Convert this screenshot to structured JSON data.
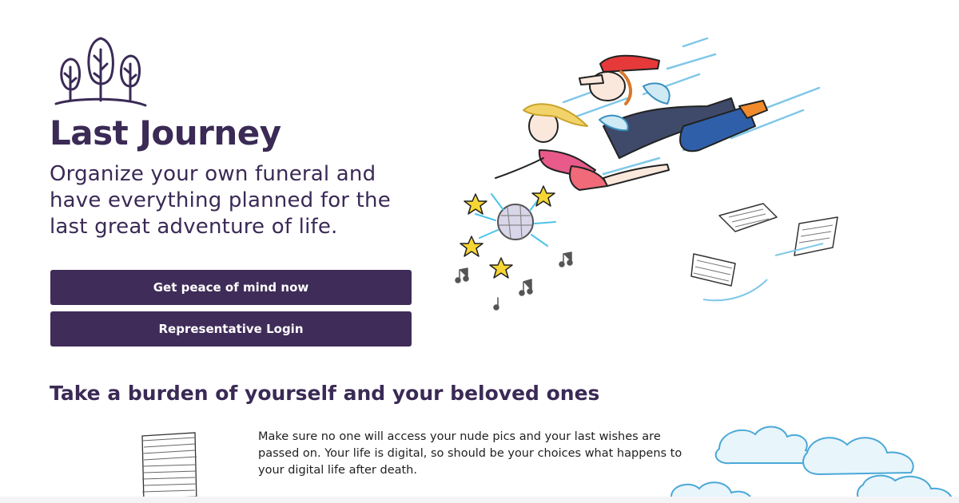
{
  "brand": {
    "title": "Last Journey",
    "logo_icon": "three-trees-icon",
    "colors": {
      "primary": "#3f2c58",
      "text": "#3a2a55"
    }
  },
  "hero": {
    "tagline": "Organize your own funeral and have everything planned for the last great adventure of life.",
    "primary_button_label": "Get peace of mind now",
    "login_button_label": "Representative Login",
    "illustration": "flying-couple-illustration"
  },
  "section": {
    "heading": "Take a burden of yourself and your beloved ones",
    "body": "Make sure no one will access your nude pics and your last wishes are passed on. Your life is digital, so should be your choices what happens to your digital life after death."
  }
}
